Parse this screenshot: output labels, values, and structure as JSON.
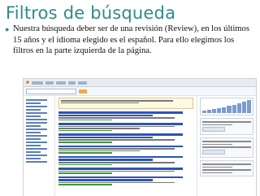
{
  "slide": {
    "title": "Filtros de búsqueda",
    "bullet": "Nuestra búsqueda deber ser de una revisión (Review), en los últimos 15 años y el idioma elegido es el español. Para ello elegimos los filtros en la parte izquierda de la página."
  },
  "colors": {
    "title": "#2e8b8b",
    "link": "#2a55b4",
    "accent": "#f0a848"
  }
}
